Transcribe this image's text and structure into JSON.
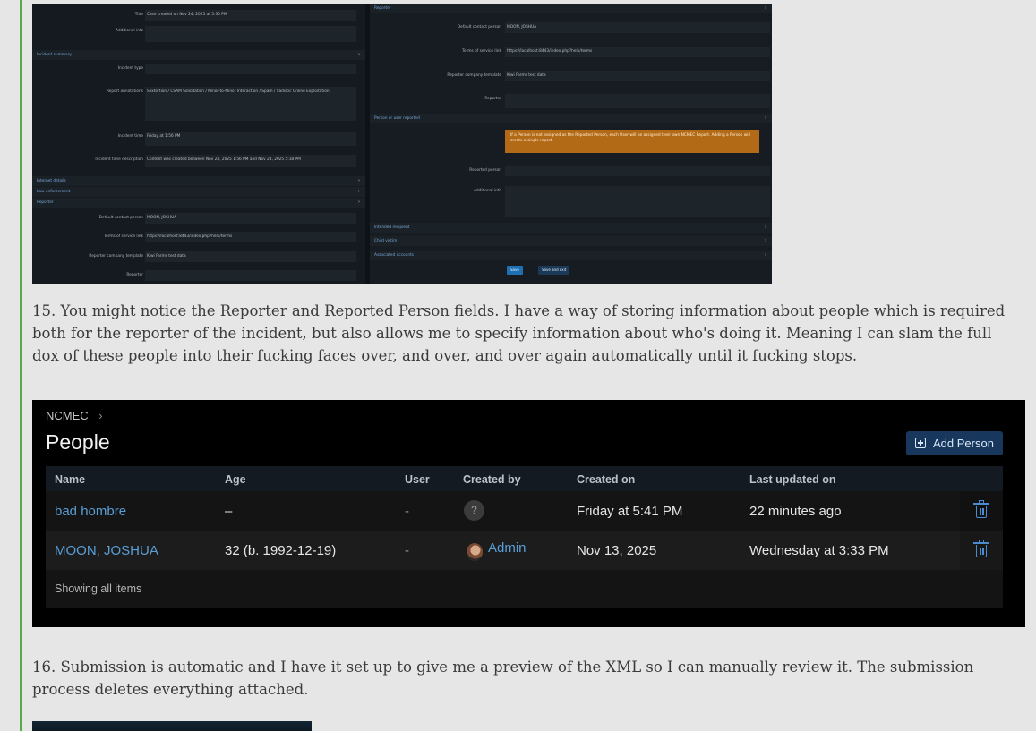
{
  "form_shot": {
    "left": [
      {
        "label": "Title",
        "value": "Case created on Nov 24, 2025 at 5:30 PM"
      },
      {
        "label": "Additional info",
        "value": ""
      },
      {
        "section": "Incident summary"
      },
      {
        "label": "Incident type",
        "value": ""
      },
      {
        "label": "Report annotations",
        "value": "Sextortion / CSAM Solicitation / Minor-to-Minor Interaction / Spam / Sadistic Online Exploitation"
      },
      {
        "label": "Incident time",
        "value": "Friday at 1:56 PM"
      },
      {
        "label": "Incident time description",
        "value": "Content was created between Nov 24, 2025 1:56 PM and Nov 24, 2025 5:18 PM"
      },
      {
        "section": "Internet details"
      },
      {
        "section": "Law enforcement"
      },
      {
        "section": "Reporter"
      },
      {
        "label": "Default contact person",
        "value": "MOON, JOSHUA"
      },
      {
        "label": "Terms of service link",
        "value": "https://localhost:8443/index.php?help/terms"
      },
      {
        "label": "Reporter company template",
        "value": "Kiwi Farms test data"
      },
      {
        "label": "Reporter",
        "value": ""
      }
    ],
    "right": [
      {
        "section": "Reporter"
      },
      {
        "label": "Default contact person",
        "value": "MOON, JOSHUA"
      },
      {
        "label": "Terms of service link",
        "value": "https://localhost:8443/index.php?help/terms"
      },
      {
        "label": "Reporter company template",
        "value": "Kiwi Farms test data"
      },
      {
        "label": "Reporter",
        "value": ""
      },
      {
        "section": "Person or user reported"
      },
      {
        "warning": "If a Person is not assigned as the Reported Person, each User will be assigned their own NCMEC Report. Adding a Person will create a single report."
      },
      {
        "label": "Reported person",
        "value": ""
      },
      {
        "label": "Additional info",
        "value": ""
      },
      {
        "section": "Intended recipient"
      },
      {
        "section": "Child victim"
      },
      {
        "section": "Associated accounts"
      }
    ],
    "save_label": "Save",
    "save_exit_label": "Save and exit"
  },
  "paragraph15": "15. You might notice the Reporter and Reported Person fields. I have a way of storing information about people which is required both for the reporter of the incident, but also allows me to specify information about who's doing it. Meaning I can slam the full dox of these people into their fucking faces over, and over, and over again automatically until it fucking stops.",
  "people": {
    "breadcrumb": "NCMEC",
    "breadcrumb_sep": "›",
    "title": "People",
    "add_button": "Add Person",
    "columns": [
      "Name",
      "Age",
      "User",
      "Created by",
      "Created on",
      "Last updated on"
    ],
    "rows": [
      {
        "name": "bad hombre",
        "age": "–",
        "user": "-",
        "created_by": "?",
        "created_on": "Friday at 5:41 PM",
        "updated_on": "22 minutes ago"
      },
      {
        "name": "MOON, JOSHUA",
        "age": "32 (b. 1992-12-19)",
        "user": "-",
        "created_by": "Admin",
        "created_on": "Nov 13, 2025",
        "updated_on": "Wednesday at 3:33 PM"
      }
    ],
    "footer": "Showing all items"
  },
  "paragraph16": "16. Submission is automatic and I have it set up to give me a preview of the XML so I can manually review it. The submission process deletes everything attached."
}
